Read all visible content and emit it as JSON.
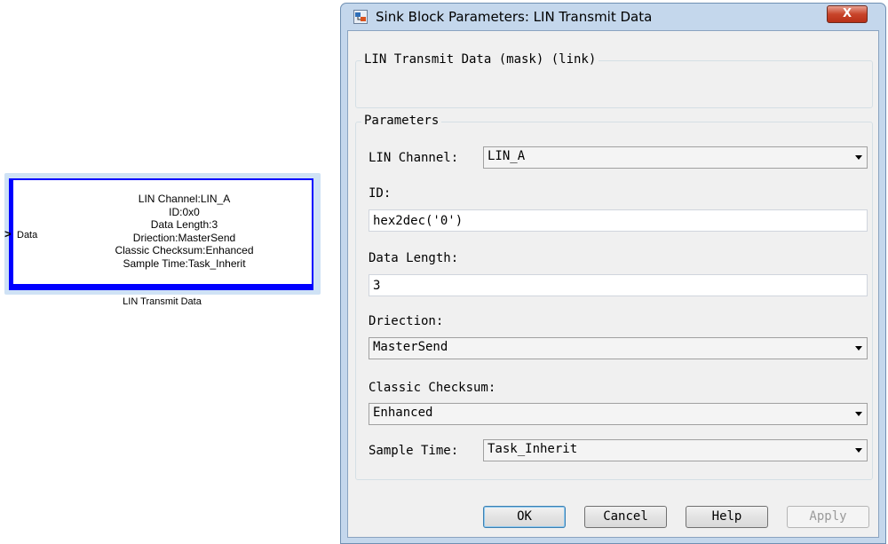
{
  "canvas": {
    "block": {
      "lines": [
        "LIN Channel:LIN_A",
        "ID:0x0",
        "Data Length:3",
        "Driection:MasterSend",
        "Classic Checksum:Enhanced",
        "Sample Time:Task_Inherit"
      ],
      "input_port_label": "Data",
      "port_arrow": ">",
      "name": "LIN Transmit Data"
    }
  },
  "dialog": {
    "title": "Sink Block Parameters: LIN Transmit Data",
    "close_glyph": "X",
    "description_group": "LIN Transmit Data (mask) (link)",
    "parameters_group": "Parameters",
    "fields": {
      "lin_channel": {
        "label": "LIN Channel:",
        "value": "LIN_A"
      },
      "id": {
        "label": "ID:",
        "value": "hex2dec('0')"
      },
      "data_length": {
        "label": "Data Length:",
        "value": "3"
      },
      "direction": {
        "label": "Driection:",
        "value": "MasterSend"
      },
      "classic_checksum": {
        "label": "Classic Checksum:",
        "value": "Enhanced"
      },
      "sample_time": {
        "label": "Sample Time:",
        "value": "Task_Inherit"
      }
    },
    "buttons": {
      "ok": "OK",
      "cancel": "Cancel",
      "help": "Help",
      "apply": "Apply"
    }
  },
  "colors": {
    "block_border": "#0000ff",
    "title_bar": "#c4d7ec",
    "close_button": "#c8442a"
  },
  "icons": {
    "title_icon": "simulink-block-icon",
    "dropdown": "chevron-down-icon"
  }
}
